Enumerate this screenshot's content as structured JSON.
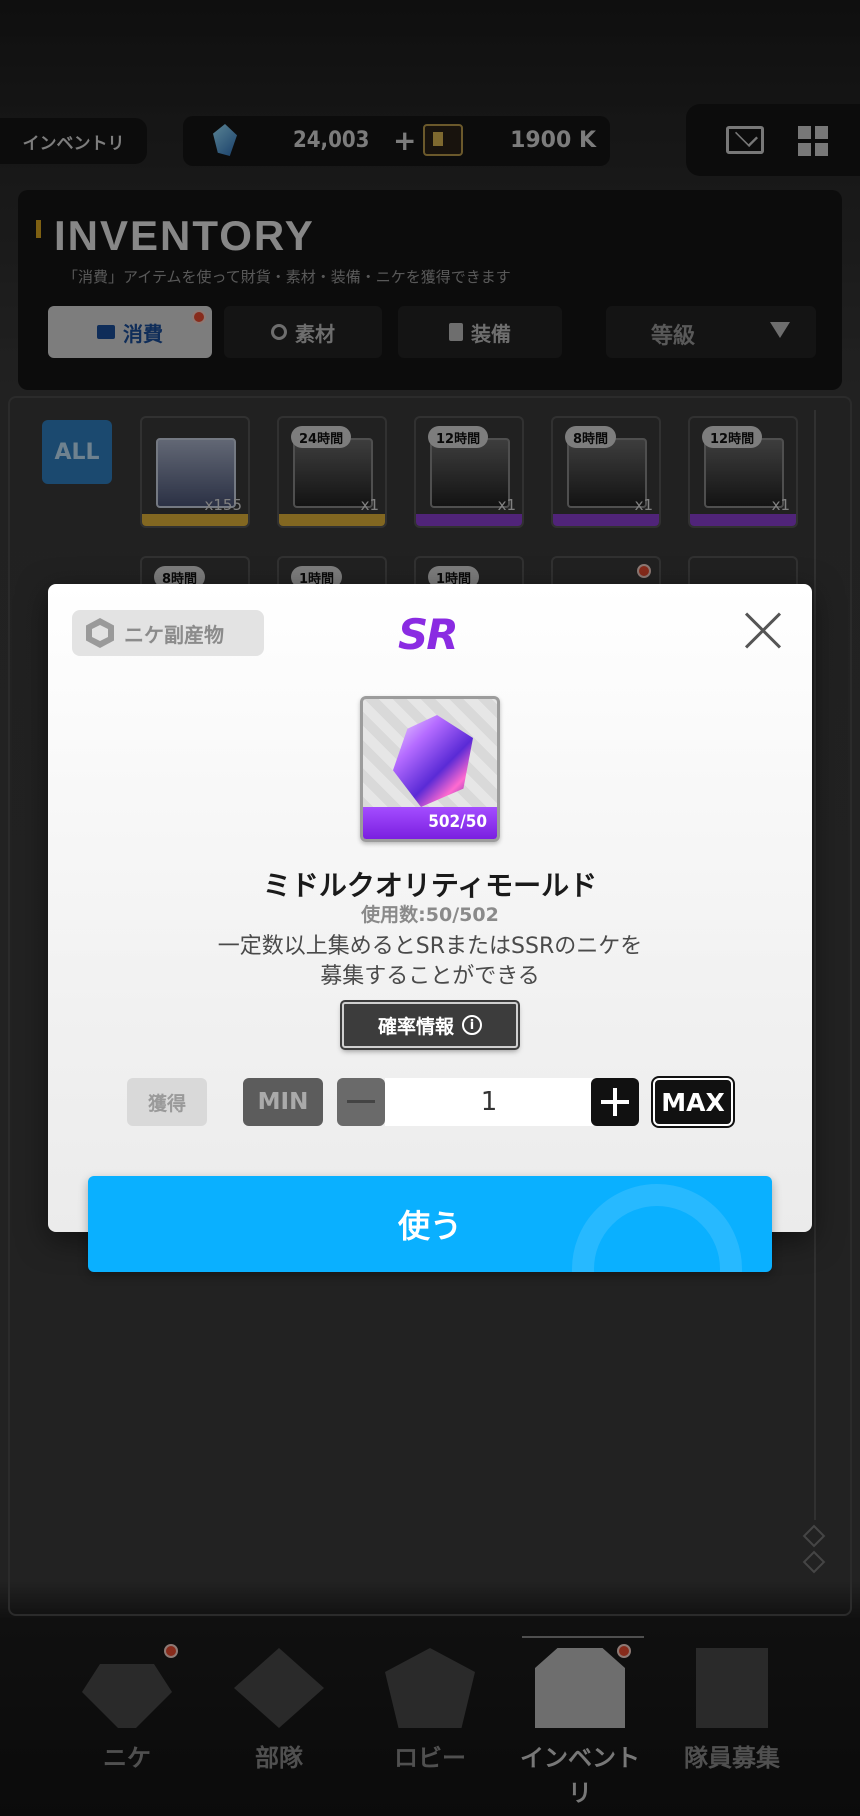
{
  "topbar": {
    "location": "インベントリ",
    "gems": "24,003",
    "gem_plus": "+",
    "credits": "1900 K"
  },
  "inventory": {
    "title": "INVENTORY",
    "subtitle": "「消費」アイテムを使って財貨・素材・装備・ニケを獲得できます",
    "tabs": [
      {
        "label": "消費",
        "active": true,
        "badge": true
      },
      {
        "label": "素材",
        "active": false
      },
      {
        "label": "装備",
        "active": false
      }
    ],
    "grade_filter": "等級",
    "all_label": "ALL",
    "items": [
      {
        "timer": "",
        "count": "x155",
        "stripe": "#e0b23a"
      },
      {
        "timer": "24時間",
        "count": "x1",
        "stripe": "#e0b23a"
      },
      {
        "timer": "12時間",
        "count": "x1",
        "stripe": "#8a3fd0"
      },
      {
        "timer": "8時間",
        "count": "x1",
        "stripe": "#8a3fd0"
      },
      {
        "timer": "12時間",
        "count": "x1",
        "stripe": "#8a3fd0"
      }
    ],
    "items_row2_timers": [
      "8時間",
      "1時間",
      "1時間",
      "",
      ""
    ]
  },
  "nav": [
    {
      "label": "ニケ",
      "active": false
    },
    {
      "label": "部隊",
      "active": false
    },
    {
      "label": "ロビー",
      "active": false
    },
    {
      "label": "インベントリ",
      "active": true
    },
    {
      "label": "隊員募集",
      "active": false
    }
  ],
  "modal": {
    "category": "ニケ副産物",
    "rarity": "SR",
    "item_qty": "502/50",
    "item_name": "ミドルクオリティモールド",
    "usage": "使用数:50/502",
    "description_line1": "一定数以上集めるとSRまたはSSRのニケを",
    "description_line2": "募集することができる",
    "rate_info": "確率情報",
    "acquire": "獲得",
    "min": "MIN",
    "max": "MAX",
    "quantity": "1",
    "use": "使う"
  },
  "colors": {
    "accent": "#0ab0ff",
    "rarity_sr": "#8a2be2"
  }
}
